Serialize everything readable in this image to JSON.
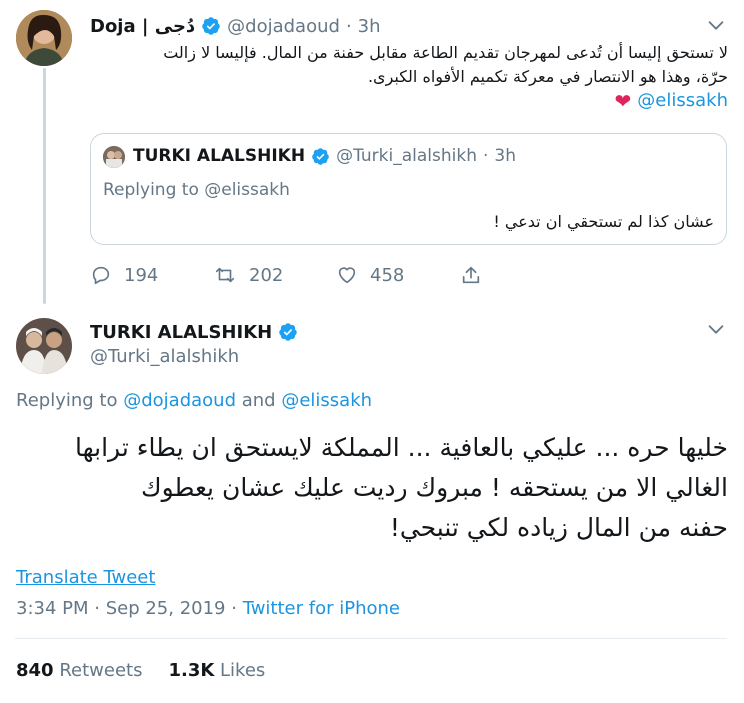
{
  "reply_tweet": {
    "author_name": "Doja | دُجى",
    "author_handle": "@dojadaoud",
    "separator": "·",
    "time": "3h",
    "text_line1": "لا تستحق إليسا أن تُدعى لمهرجان تقديم الطاعة مقابل حفنة من المال. فإليسا لا زالت",
    "text_line2": "حرّة، وهذا هو الانتصار في معركة تكميم الأفواه الكبرى.",
    "mention": "@elissakh",
    "heart": "❤",
    "quoted": {
      "author_name": "TURKI ALALSHIKH",
      "author_handle": "@Turki_alalshikh",
      "separator": "·",
      "time": "3h",
      "replying_to": "Replying to @elissakh",
      "text": "عشان كذا لم تستحقي ان تدعي !"
    },
    "actions": {
      "replies": "194",
      "retweets": "202",
      "likes": "458"
    }
  },
  "main_tweet": {
    "author_name": "TURKI ALALSHIKH",
    "author_handle": "@Turki_alalshikh",
    "replying_prefix": "Replying to",
    "replying_user1": "@dojadaoud",
    "replying_and": "and",
    "replying_user2": "@elissakh",
    "text_line1": "خليها حره ... عليكي بالعافية ... المملكة لايستحق ان يطاء ترابها",
    "text_line2": "الغالي الا من يستحقه ! مبروك رديت عليك عشان يعطوك",
    "text_line3": "حفنه من المال زياده لكي تنبحي!",
    "translate_label": "Translate Tweet",
    "timestamp": "3:34 PM · Sep 25, 2019 ·",
    "source": "Twitter for iPhone",
    "retweets_count": "840",
    "retweets_label": "Retweets",
    "likes_count": "1.3K",
    "likes_label": "Likes"
  },
  "colors": {
    "link": "#1b95e0",
    "verified": "#1da1f2",
    "muted": "#657786",
    "heart": "#e0245e"
  }
}
